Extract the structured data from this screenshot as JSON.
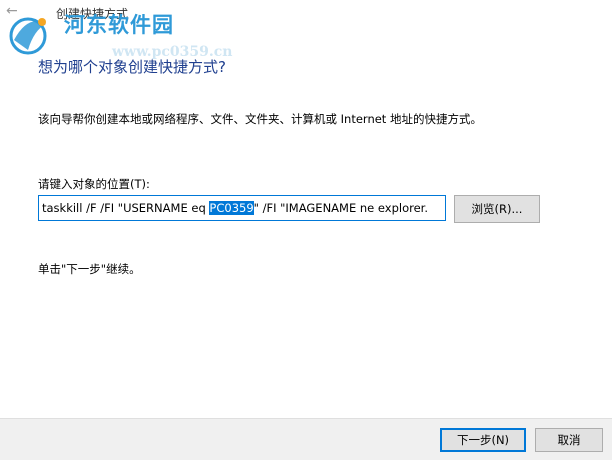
{
  "window": {
    "title": "创建快捷方式",
    "back_icon": "arrow-left-icon"
  },
  "watermark": {
    "name": "河东软件园",
    "url": "www.pc0359.cn",
    "logo_icon": "hedong-logo-icon"
  },
  "wizard": {
    "heading": "想为哪个对象创建快捷方式?",
    "description": "该向导帮你创建本地或网络程序、文件、文件夹、计算机或 Internet 地址的快捷方式。",
    "location_label": "请键入对象的位置(T):",
    "location_value_before": "taskkill /F /FI \"USERNAME eq ",
    "location_value_selected": "PC0359",
    "location_value_after": "\" /FI \"IMAGENAME ne explorer.",
    "browse_label": "浏览(R)...",
    "hint": "单击\"下一步\"继续。"
  },
  "footer": {
    "next_label": "下一步(N)",
    "cancel_label": "取消"
  },
  "colors": {
    "accent": "#0078d7",
    "heading": "#1f3f8f",
    "watermark": "#2f9ad8"
  }
}
